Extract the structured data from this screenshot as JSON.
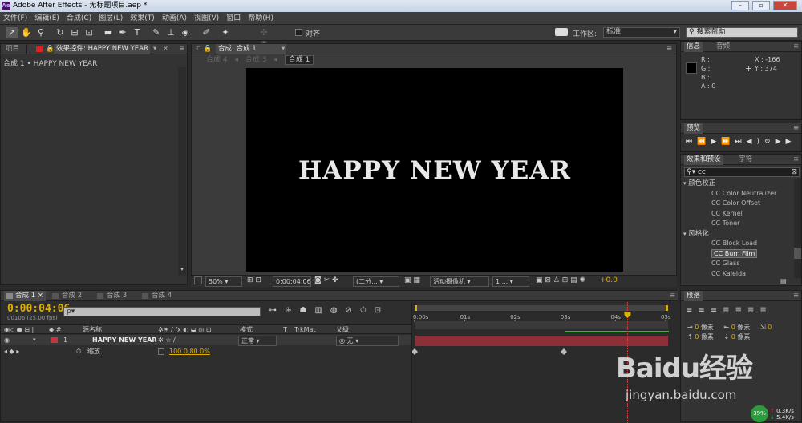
{
  "window": {
    "title": "Adobe After Effects - 无标题项目.aep *",
    "logo": "Ae"
  },
  "menu": [
    "文件(F)",
    "编辑(E)",
    "合成(C)",
    "图层(L)",
    "效果(T)",
    "动画(A)",
    "视图(V)",
    "窗口",
    "帮助(H)"
  ],
  "toolbar": {
    "snap_label": "对齐",
    "workspace_label": "工作区:",
    "workspace_value": "标准",
    "search_placeholder": "搜索帮助"
  },
  "project_panel": {
    "tab_project": "项目",
    "tab_effects": "效果控件: HAPPY NEW YEAR",
    "breadcrumb": "合成 1 • HAPPY NEW YEAR"
  },
  "composition": {
    "tab_label": "合成: 合成 1",
    "sub_tabs": [
      "合成 4",
      "合成 3",
      "合成 1"
    ],
    "text": "HAPPY NEW YEAR",
    "zoom": "50%",
    "timecode": "0:00:04:06",
    "resolution": "(二分...",
    "camera": "活动摄像机",
    "views": "1 ...",
    "exposure": "+0.0"
  },
  "info_panel": {
    "tab_info": "信息",
    "tab_audio": "音频",
    "r": "R :",
    "g": "G :",
    "b": "B :",
    "a": "A : 0",
    "x": "X : -166",
    "y": "Y : 374"
  },
  "preview_panel": {
    "tab": "预览"
  },
  "effects_panel": {
    "tab_effects": "效果和预设",
    "tab_char": "字符",
    "search_value": "cc",
    "groups": [
      {
        "name": "颜色校正",
        "items": [
          "CC Color Neutralizer",
          "CC Color Offset",
          "CC Kernel",
          "CC Toner"
        ]
      },
      {
        "name": "风格化",
        "items": [
          "CC Block Load",
          "CC Burn Film",
          "CC Glass",
          "CC Kaleida"
        ]
      }
    ],
    "selected": "CC Burn Film"
  },
  "paragraph_panel": {
    "tab": "段落",
    "unit": "像素",
    "values": [
      "0",
      "0",
      "0",
      "0",
      "0"
    ]
  },
  "timeline": {
    "tabs": [
      "合成 1",
      "合成 2",
      "合成 3",
      "合成 4"
    ],
    "timecode": "0:00:04:06",
    "frame_info": "00106 (25.00 fps)",
    "search_placeholder": "ρ▾",
    "columns": {
      "source": "源名称",
      "mode": "模式",
      "t": "T",
      "trkmat": "TrkMat",
      "parent": "父级"
    },
    "layer": {
      "index": "1",
      "name": "HAPPY NEW YEAR",
      "mode": "正常",
      "parent": "无"
    },
    "property": {
      "name": "缩放",
      "value": "100.0,80.0%"
    },
    "ruler": [
      "0:00s",
      "01s",
      "02s",
      "03s",
      "04s",
      "05s"
    ],
    "current_time_seconds": 4.24
  },
  "status": {
    "cpu": "39%",
    "up": "0.3K/s",
    "down": "5.4K/s"
  },
  "watermark": {
    "brand": "Baidu经验",
    "url": "jingyan.baidu.com"
  },
  "colors": {
    "accent": "#e0b000",
    "layer_bar": "#8c2f37",
    "label_red": "#c8343d"
  }
}
